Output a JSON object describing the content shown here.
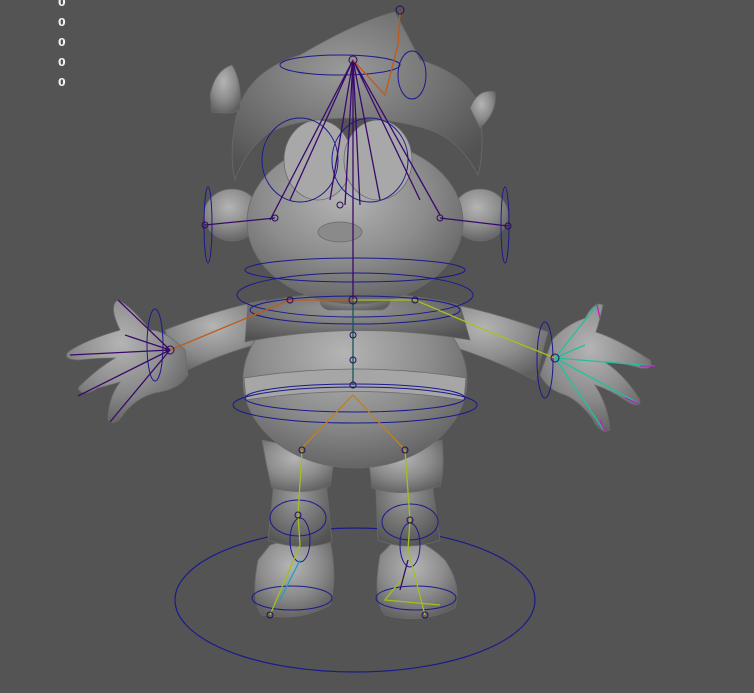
{
  "viewport": {
    "background": "#545454",
    "mesh_color": "#8e8e8e",
    "control_color": "#1a1a8c",
    "joint_color": "#2a0a5a"
  },
  "hud": {
    "values": [
      "0",
      "0",
      "0",
      "0",
      "0"
    ]
  }
}
